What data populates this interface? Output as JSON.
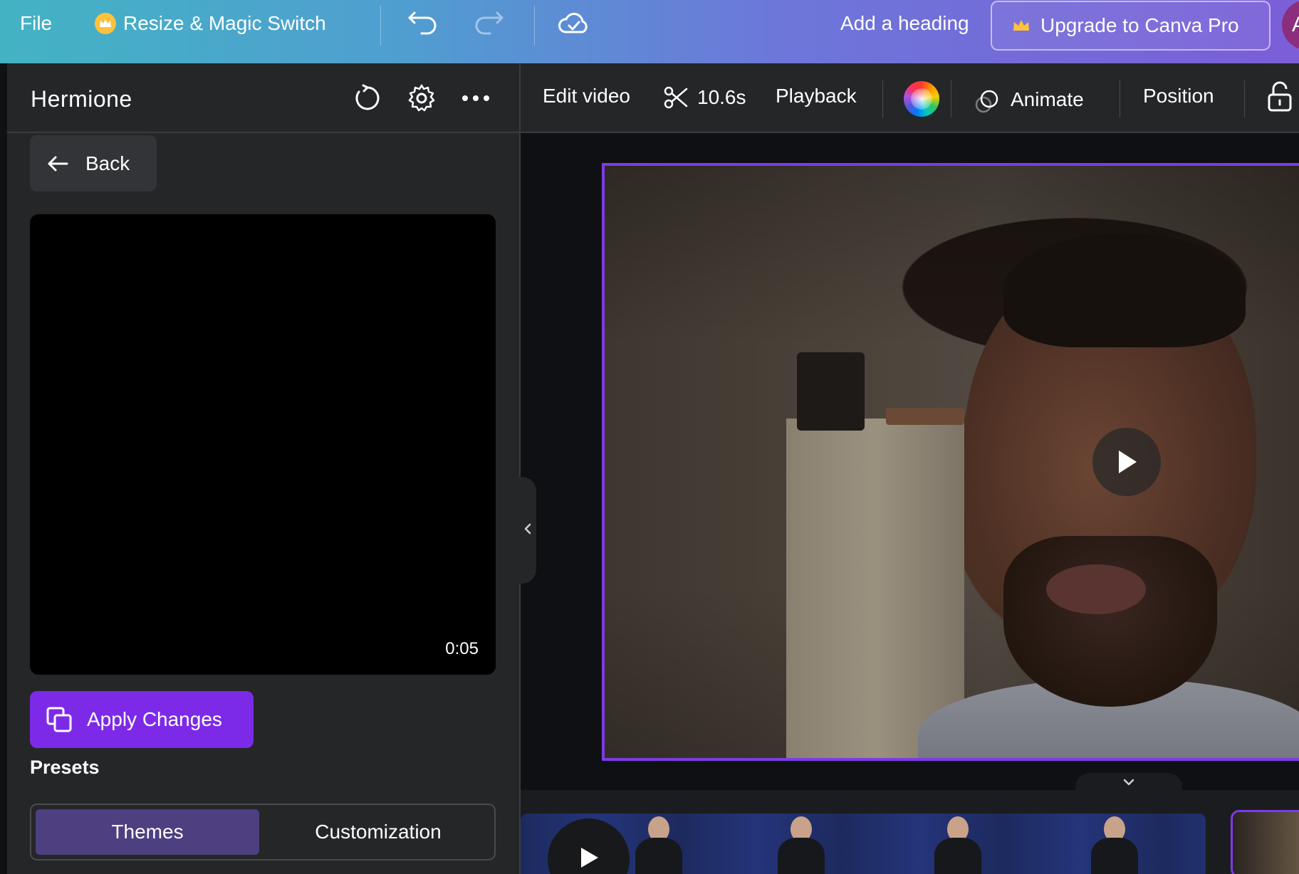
{
  "topbar": {
    "file_label": "File",
    "resize_label": "Resize & Magic Switch",
    "add_heading_label": "Add a heading",
    "upgrade_label": "Upgrade to Canva Pro",
    "avatar_initial": "A"
  },
  "left_panel": {
    "title": "Hermione",
    "back_label": "Back",
    "preview_time": "0:05",
    "apply_label": "Apply Changes",
    "presets_label": "Presets",
    "tabs": [
      {
        "label": "Themes",
        "active": true
      },
      {
        "label": "Customization",
        "active": false
      }
    ]
  },
  "toolbar": {
    "edit_video_label": "Edit video",
    "duration_label": "10.6s",
    "playback_label": "Playback",
    "animate_label": "Animate",
    "position_label": "Position"
  },
  "colors": {
    "accent": "#7d2ae8",
    "panel_bg": "#252628",
    "selection_border": "#7d3ae8",
    "active_tab": "#4d3f80"
  },
  "icons": [
    "crown-icon",
    "undo-icon",
    "redo-icon",
    "cloud-saved-icon",
    "refresh-icon",
    "gear-icon",
    "more-icon",
    "arrow-left-icon",
    "copy-icon",
    "scissors-icon",
    "color-wheel-icon",
    "animate-icon",
    "lock-icon",
    "play-icon",
    "chevron-left-icon",
    "chevron-down-icon"
  ]
}
